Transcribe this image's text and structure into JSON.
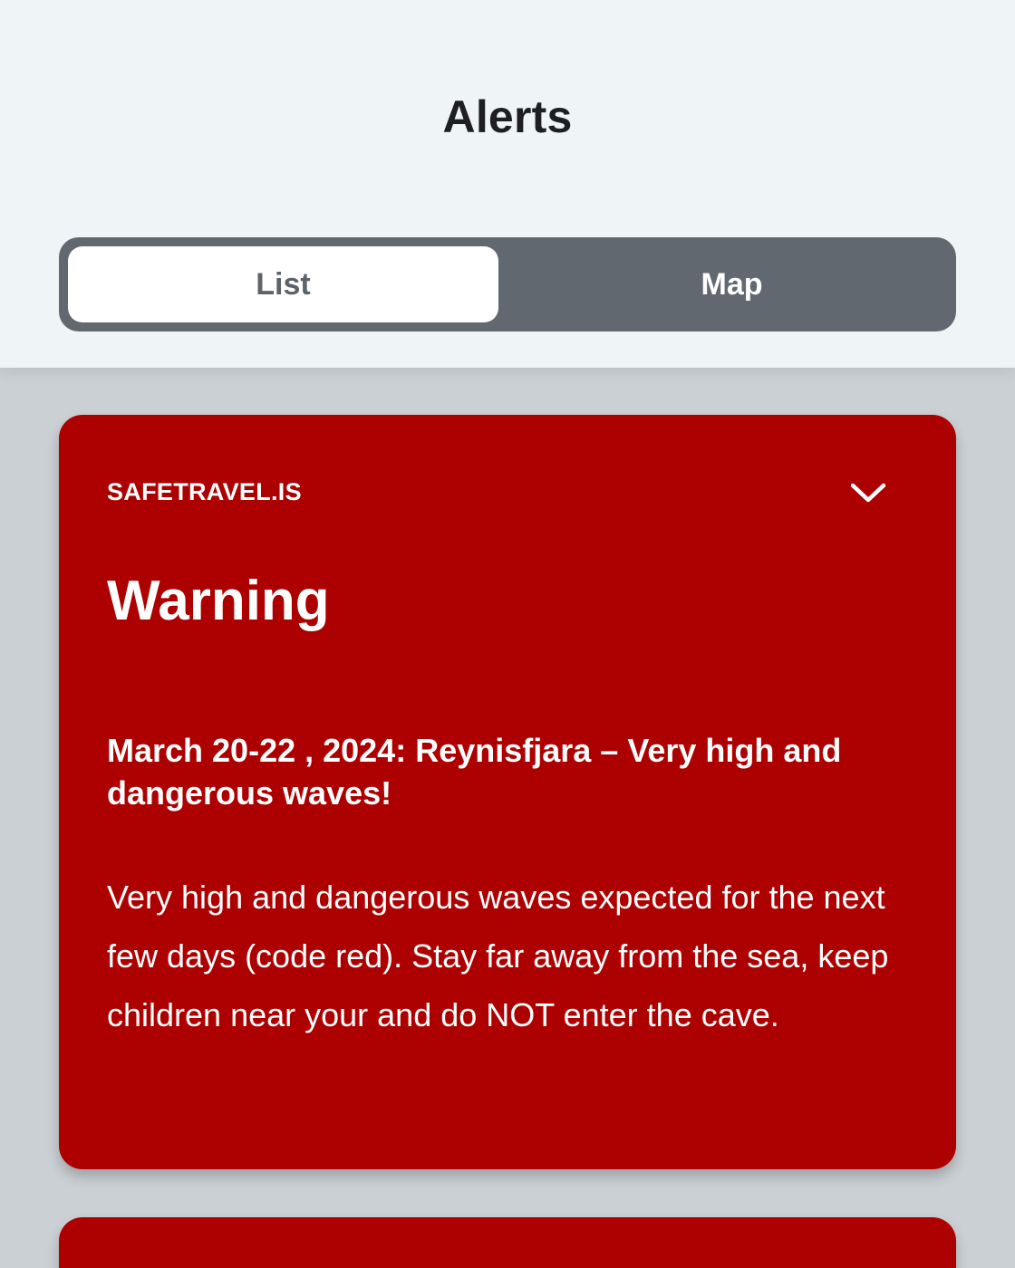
{
  "header": {
    "title": "Alerts",
    "tabs": {
      "list_label": "List",
      "map_label": "Map",
      "selected": "List"
    }
  },
  "alerts": [
    {
      "source": "SAFETRAVEL.IS",
      "level": "Warning",
      "headline": "March 20-22 , 2024: Reynisfjara – Very high and dangerous waves!",
      "body": "Very high and dangerous waves expected for the next few days (code red). Stay far away from the sea, keep children near your and do NOT enter the cave.",
      "expand_icon": "chevron-down-icon",
      "color": "#ad0000"
    }
  ],
  "colors": {
    "header_bg": "#eff4f7",
    "content_bg": "#cbd0d4",
    "segmented_bg": "#626870",
    "alert_red": "#ad0000"
  }
}
